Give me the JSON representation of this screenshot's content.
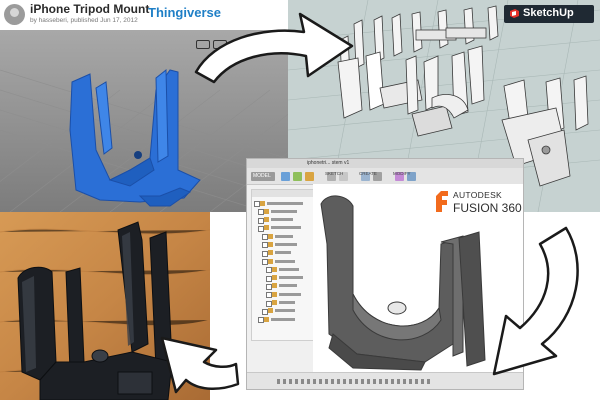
{
  "thingiverse": {
    "title": "iPhone Tripod Mount",
    "byline": "by hasseberi, published Jun 17, 2012",
    "brand": "Thingiverse",
    "model_color": "#2b6fd6"
  },
  "sketchup": {
    "brand": "SketchUp",
    "badge_bg": "#1f2933",
    "logo_color": "#e4322b"
  },
  "fusion": {
    "logo_line1": "AUTODESK",
    "logo_line2": "FUSION 360",
    "tab_title": "iphonetri...   stem v1",
    "toolbar": {
      "model": "MODEL",
      "sketch": "SKETCH",
      "create": "CREATE",
      "modify": "MODIFY"
    },
    "logo_color": "#f26b1d",
    "model_color": "#5d5d5d"
  },
  "photo": {
    "print_color": "#1c1f24",
    "surface_color": "#c98a4a"
  },
  "icons": [
    "model-mode-icon",
    "sketchup-logo-icon",
    "fusion-logo-icon",
    "curved-arrow-icon"
  ]
}
